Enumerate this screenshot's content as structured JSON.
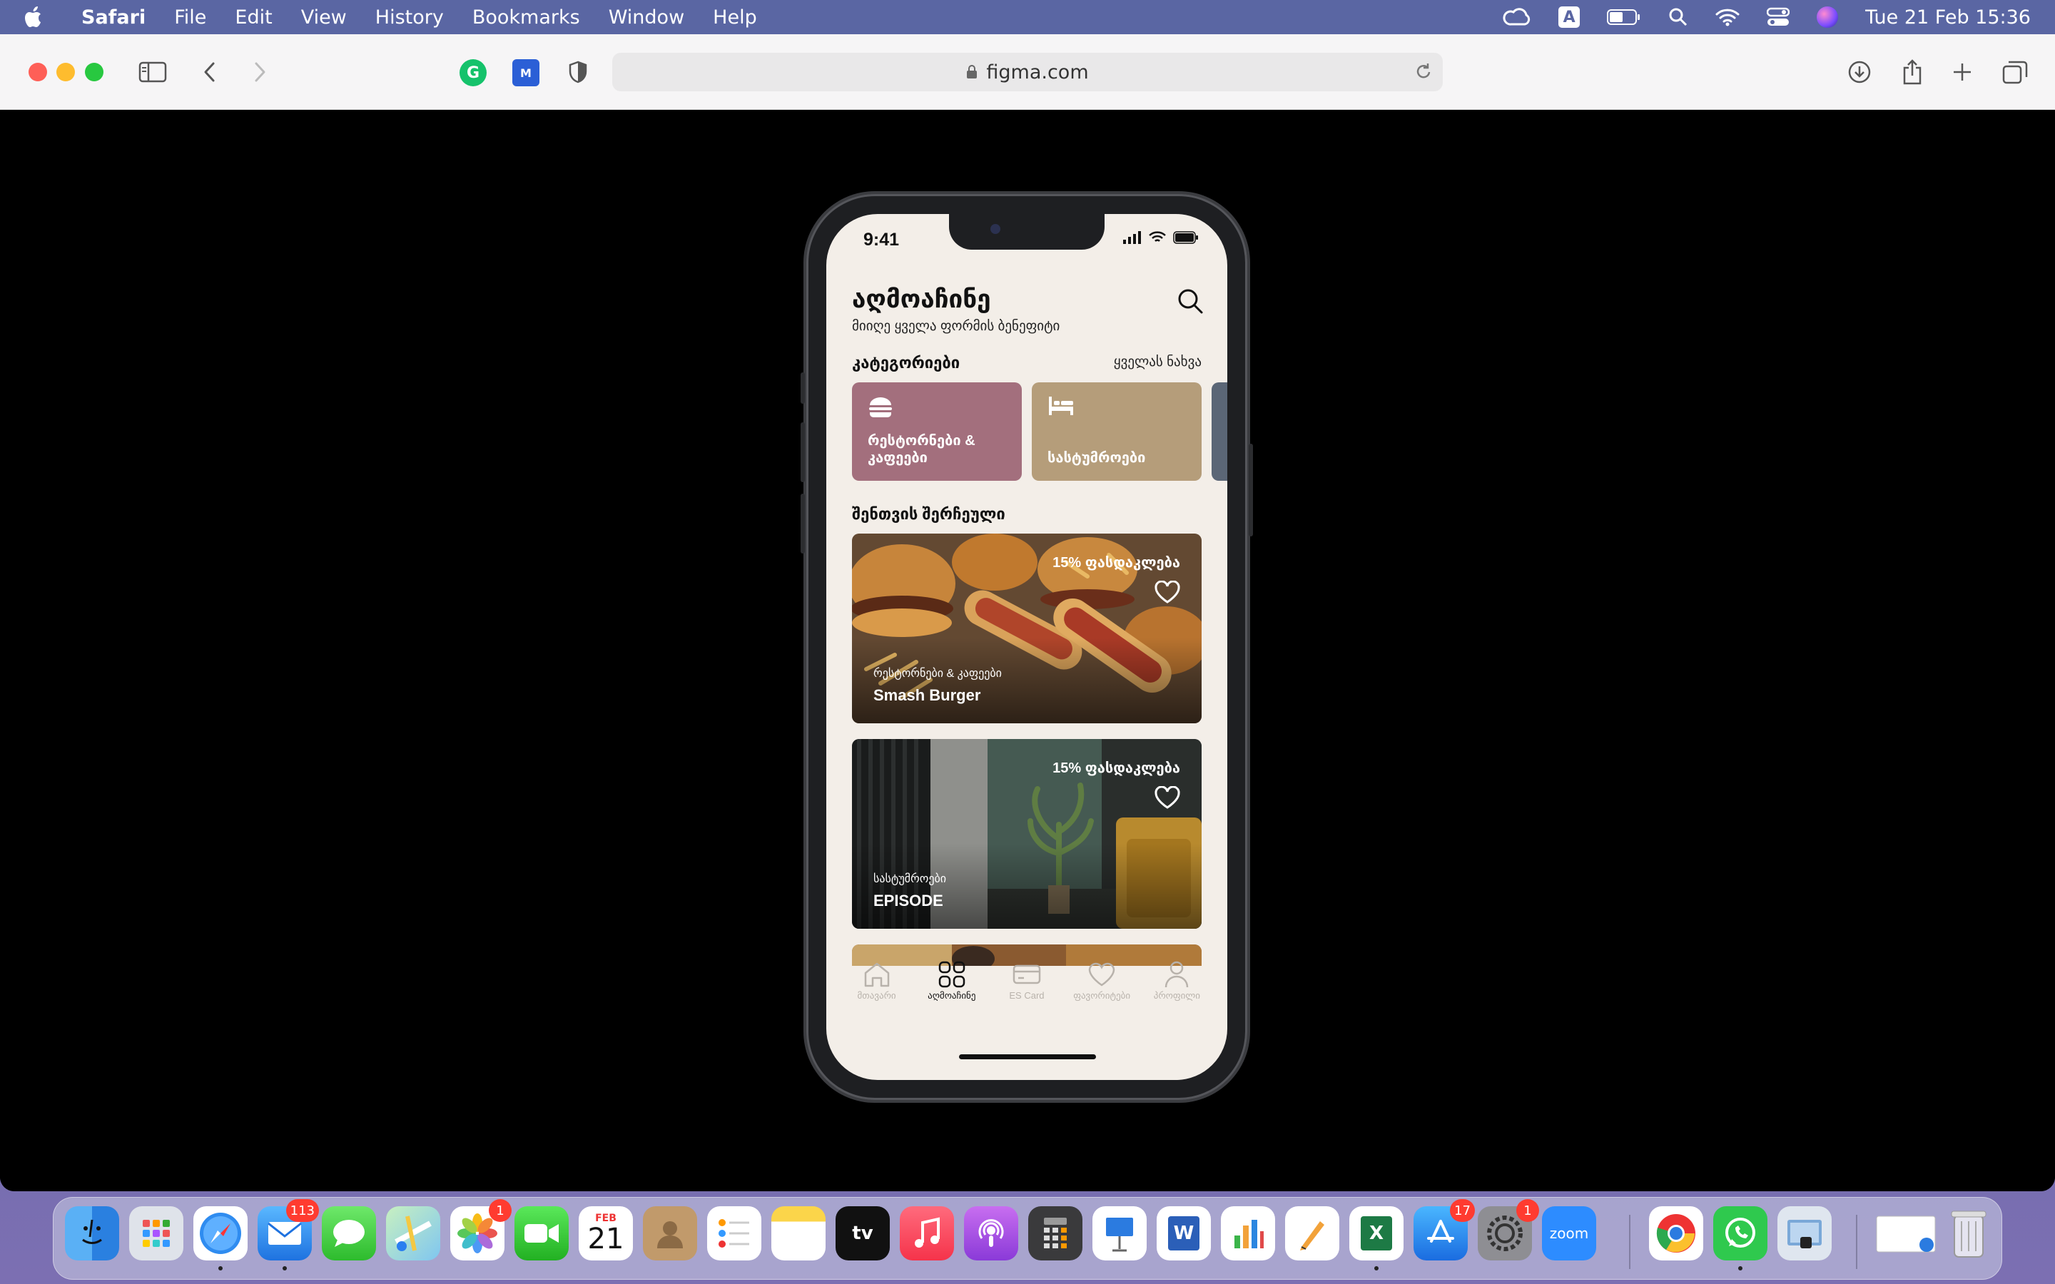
{
  "menubar": {
    "app_name": "Safari",
    "items": [
      "File",
      "Edit",
      "View",
      "History",
      "Bookmarks",
      "Window",
      "Help"
    ],
    "input_source": "A",
    "clock": "Tue 21 Feb  15:36"
  },
  "browser": {
    "url": "figma.com"
  },
  "app": {
    "status_time": "9:41",
    "title": "აღმოაჩინე",
    "subtitle": "მიიღე ყველა ფორმის ბენეფიტი",
    "categories_title": "კატეგორიები",
    "see_all": "ყველას ნახვა",
    "categories": [
      {
        "label": "რესტორნები & კაფეები",
        "color": "#a36f7d",
        "icon": "burger-icon"
      },
      {
        "label": "სასტუმროები",
        "color": "#b59d7a",
        "icon": "bed-icon"
      }
    ],
    "recommended_title": "შენთვის შერჩეული",
    "offers": [
      {
        "discount": "15% ფასდაკლება",
        "category": "რესტორნები & კაფეები",
        "name": "Smash Burger"
      },
      {
        "discount": "15% ფასდაკლება",
        "category": "სასტუმროები",
        "name": "EPISODE"
      }
    ],
    "tabs": [
      {
        "label": "მთავარი",
        "icon": "home-icon",
        "active": false
      },
      {
        "label": "აღმოაჩინე",
        "icon": "grid-icon",
        "active": true
      },
      {
        "label": "ES Card",
        "icon": "card-icon",
        "active": false
      },
      {
        "label": "ფავორიტები",
        "icon": "heart-icon",
        "active": false
      },
      {
        "label": "პროფილი",
        "icon": "profile-icon",
        "active": false
      }
    ]
  },
  "dock": {
    "apps": [
      {
        "name": "Finder"
      },
      {
        "name": "Launchpad"
      },
      {
        "name": "Safari"
      },
      {
        "name": "Mail",
        "badge": "113"
      },
      {
        "name": "Messages"
      },
      {
        "name": "Maps"
      },
      {
        "name": "Photos",
        "badge": "1"
      },
      {
        "name": "FaceTime"
      },
      {
        "name": "Calendar",
        "month": "FEB",
        "day": "21"
      },
      {
        "name": "Contacts"
      },
      {
        "name": "Reminders"
      },
      {
        "name": "Notes"
      },
      {
        "name": "TV",
        "label": "tv"
      },
      {
        "name": "Music"
      },
      {
        "name": "Podcasts"
      },
      {
        "name": "Calculator"
      },
      {
        "name": "Keynote"
      },
      {
        "name": "Word",
        "label": "W"
      },
      {
        "name": "Numbers"
      },
      {
        "name": "Pages"
      },
      {
        "name": "Excel",
        "label": "X"
      },
      {
        "name": "App Store",
        "badge": "17"
      },
      {
        "name": "System Preferences",
        "badge": "1"
      },
      {
        "name": "Zoom",
        "label": "zoom"
      },
      {
        "name": "Chrome"
      },
      {
        "name": "WhatsApp"
      },
      {
        "name": "Preview"
      },
      {
        "name": "Downloads"
      },
      {
        "name": "Trash"
      }
    ]
  }
}
